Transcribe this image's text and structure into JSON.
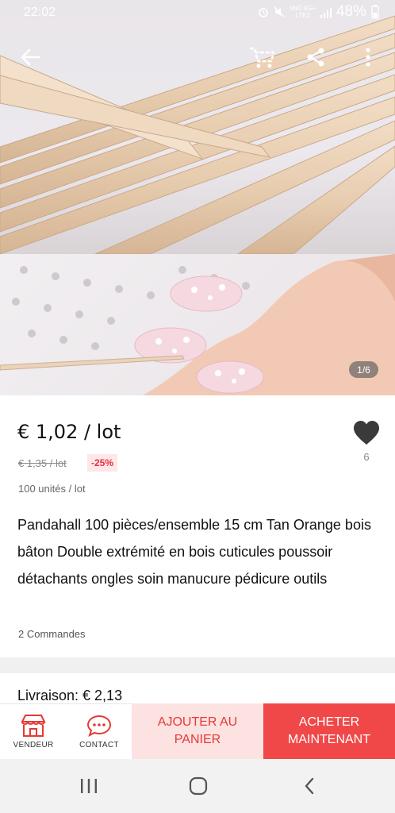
{
  "status_bar": {
    "time": "22:02",
    "network_line1": "VoD 4G+",
    "network_line2": "LTE1",
    "battery": "48%"
  },
  "top_bar": {
    "back_icon": "arrow-left-icon",
    "cart_icon": "cart-icon",
    "share_icon": "share-icon",
    "more_icon": "more-vertical-icon"
  },
  "gallery": {
    "pager": "1/6"
  },
  "product": {
    "price": "€ 1,02 / lot",
    "old_price": "€ 1,35 / lot",
    "discount": "-25%",
    "units": "100 unités / lot",
    "favorites_count": "6",
    "title": "Pandahall 100 pièces/ensemble 15 cm Tan Orange bois bâton Double extrémité en bois cuticules poussoir détachants ongles soin manucure pédicure outils",
    "orders": "2 Commandes"
  },
  "shipping": {
    "label": "Livraison: € 2,13"
  },
  "actions": {
    "seller_label": "VENDEUR",
    "contact_label": "CONTACT",
    "add_to_cart_line1": "AJOUTER AU",
    "add_to_cart_line2": "PANIER",
    "buy_now_line1": "ACHETER",
    "buy_now_line2": "MAINTENANT"
  },
  "colors": {
    "accent_red": "#f04848",
    "discount_red": "#e8303b",
    "add_cart_bg": "#fde2e2"
  }
}
